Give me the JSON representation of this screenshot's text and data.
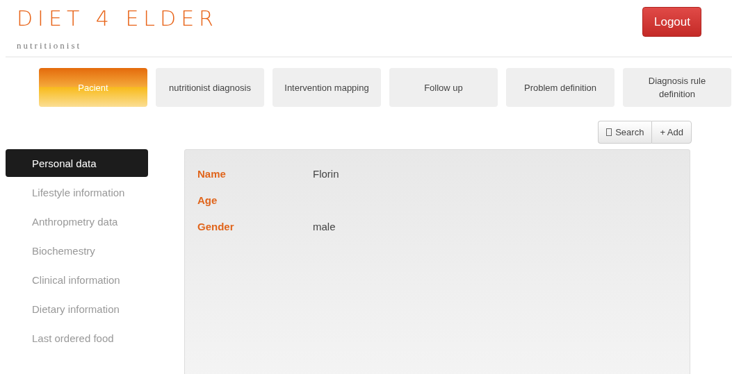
{
  "brand": {
    "title": "DIET 4 ELDER",
    "subtitle": "nutritionist"
  },
  "logout": {
    "label": "Logout"
  },
  "tabs": [
    {
      "label": "Pacient",
      "selected": true
    },
    {
      "label": "nutritionist diagnosis",
      "selected": false
    },
    {
      "label": "Intervention mapping",
      "selected": false
    },
    {
      "label": "Follow up",
      "selected": false
    },
    {
      "label": "Problem definition",
      "selected": false
    },
    {
      "label": "Diagnosis rule definition",
      "selected": false
    }
  ],
  "toolbar": {
    "search": "Search",
    "add": "+ Add"
  },
  "sidebar": {
    "items": [
      {
        "label": "Personal data",
        "selected": true
      },
      {
        "label": "Lifestyle information",
        "selected": false
      },
      {
        "label": "Anthropmetry data",
        "selected": false
      },
      {
        "label": "Biochemestry",
        "selected": false
      },
      {
        "label": "Clinical information",
        "selected": false
      },
      {
        "label": "Dietary information",
        "selected": false
      },
      {
        "label": "Last ordered food",
        "selected": false
      }
    ]
  },
  "fields": [
    {
      "label": "Name",
      "value": "Florin"
    },
    {
      "label": "Age"
    },
    {
      "label": "Gender",
      "value": "male"
    }
  ]
}
